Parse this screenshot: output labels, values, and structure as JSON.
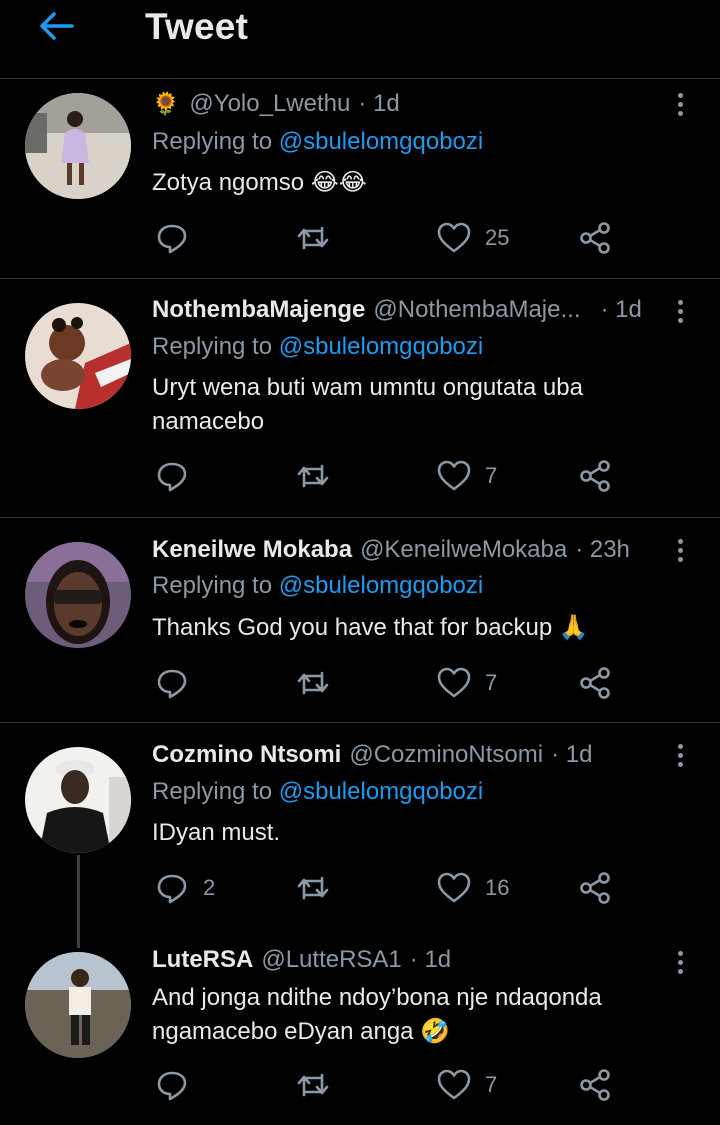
{
  "header": {
    "title": "Tweet",
    "back_icon": "arrow-left-icon",
    "accent": "#1d9bf0"
  },
  "colors": {
    "background": "#000000",
    "text": "#e7e9ea",
    "secondary": "#8b98a5",
    "link": "#1d9bf0",
    "divider": "#2f3336"
  },
  "tweets": [
    {
      "prefix_emoji": "🌻",
      "name": "",
      "handle": "@Yolo_Lwethu",
      "time": "· 1d",
      "reply_prefix": "Replying to ",
      "reply_to": "@sbulelomgqobozi",
      "text": "Zotya ngomso 😂😂",
      "replies": "",
      "likes": "25"
    },
    {
      "name": "NothembaMajenge",
      "handle": "@NothembaMaje...",
      "time": "· 1d",
      "reply_prefix": "Replying to ",
      "reply_to": "@sbulelomgqobozi",
      "text": "Uryt wena buti wam  umntu ongutata uba namacebo",
      "replies": "",
      "likes": "7"
    },
    {
      "name": "Keneilwe Mokaba",
      "handle": "@KeneilweMokaba",
      "time": "· 23h",
      "reply_prefix": "Replying to ",
      "reply_to": "@sbulelomgqobozi",
      "text": "Thanks God you have that for backup 🙏",
      "replies": "",
      "likes": "7"
    },
    {
      "name": "Cozmino Ntsomi",
      "handle": "@CozminoNtsomi",
      "time": "· 1d",
      "reply_prefix": "Replying to ",
      "reply_to": "@sbulelomgqobozi",
      "text": "IDyan must.",
      "replies": "2",
      "likes": "16"
    },
    {
      "name": "LuteRSA",
      "handle": "@LutteRSA1",
      "time": "· 1d",
      "text": "And jonga ndithe ndoy’bona nje ndaqonda ngamacebo eDyan anga 🤣",
      "replies": "",
      "likes": "7"
    }
  ]
}
